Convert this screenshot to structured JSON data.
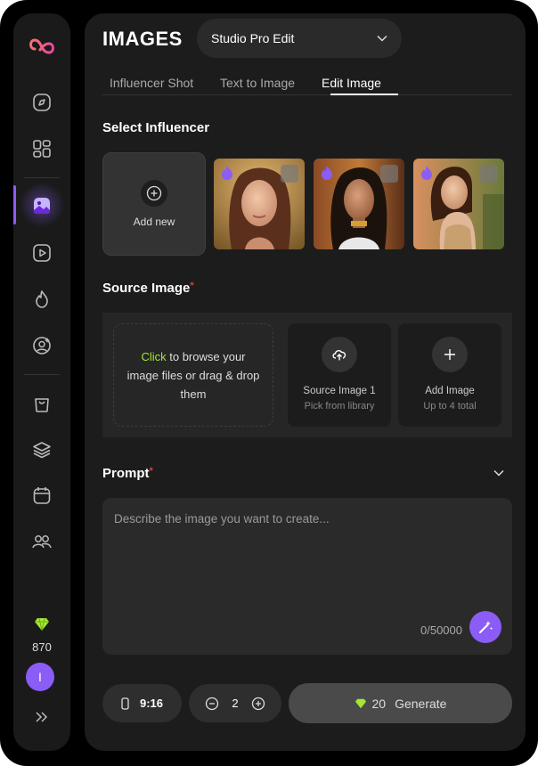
{
  "page": {
    "title": "IMAGES"
  },
  "model_select": {
    "value": "Studio Pro Edit"
  },
  "tabs": [
    {
      "label": "Influencer Shot",
      "active": false
    },
    {
      "label": "Text to Image",
      "active": false
    },
    {
      "label": "Edit Image",
      "active": true
    }
  ],
  "sidebar": {
    "items": [
      {
        "icon": "compass-icon"
      },
      {
        "icon": "grid-icon"
      },
      {
        "icon": "image-icon",
        "active": true
      },
      {
        "icon": "video-icon"
      },
      {
        "icon": "flame-icon"
      },
      {
        "icon": "user-circle-icon"
      },
      {
        "icon": "bag-icon"
      },
      {
        "icon": "layers-icon"
      },
      {
        "icon": "calendar-icon"
      },
      {
        "icon": "users-icon"
      }
    ],
    "credits": "870",
    "avatar_initial": "I",
    "accent": "#8b5cf6",
    "credit_gem_color": "#a3e635"
  },
  "select_influencer": {
    "label": "Select Influencer",
    "add_new_label": "Add new"
  },
  "source_image": {
    "label": "Source Image",
    "required_mark": "*",
    "drop_click": "Click",
    "drop_text": " to browse your image files or drag & drop them",
    "card1": {
      "line1": "Source Image 1",
      "line2": "Pick from library"
    },
    "card2": {
      "line1": "Add Image",
      "line2": "Up to 4 total"
    }
  },
  "prompt": {
    "label": "Prompt",
    "required_mark": "*",
    "placeholder": "Describe the image you want to create...",
    "counter": "0/50000"
  },
  "controls": {
    "aspect_ratio": "9:16",
    "count": "2",
    "generate_cost": "20",
    "generate_label": "Generate"
  }
}
